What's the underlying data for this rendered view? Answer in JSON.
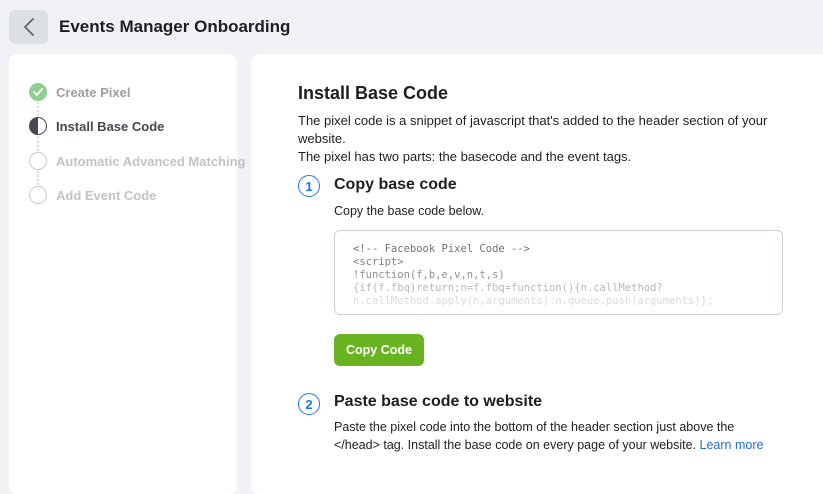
{
  "header": {
    "title": "Events Manager Onboarding",
    "back_icon": "chevron-left-icon"
  },
  "sidebar": {
    "steps": [
      {
        "label": "Create Pixel",
        "status": "complete"
      },
      {
        "label": "Install Base Code",
        "status": "in-progress"
      },
      {
        "label": "Automatic Advanced Matching",
        "status": "pending"
      },
      {
        "label": "Add Event Code",
        "status": "pending"
      }
    ]
  },
  "main": {
    "title": "Install Base Code",
    "intro_line1": "The pixel code is a snippet of javascript that's added to the header section of your website.",
    "intro_line2": "The pixel has two parts: the basecode and the event tags.",
    "section1": {
      "number": "1",
      "title": "Copy base code",
      "description": "Copy the base code below.",
      "code_lines": [
        "<!-- Facebook Pixel Code -->",
        "<script>",
        "!function(f,b,e,v,n,t,s)",
        "{if(f.fbq)return;n=f.fbq=function(){n.callMethod?",
        "n.callMethod.apply(n,arguments):n.queue.push(arguments)};"
      ],
      "button_label": "Copy Code"
    },
    "section2": {
      "number": "2",
      "title": "Paste base code to website",
      "description_line1": "Paste the pixel code into the bottom of the header section just above the",
      "description_line2": "</head> tag. Install the base code on every page of your website. ",
      "link_label": "Learn more"
    }
  },
  "colors": {
    "accent_blue": "#1877f2",
    "button_green": "#69b320",
    "complete_green": "#8fcf8f"
  }
}
